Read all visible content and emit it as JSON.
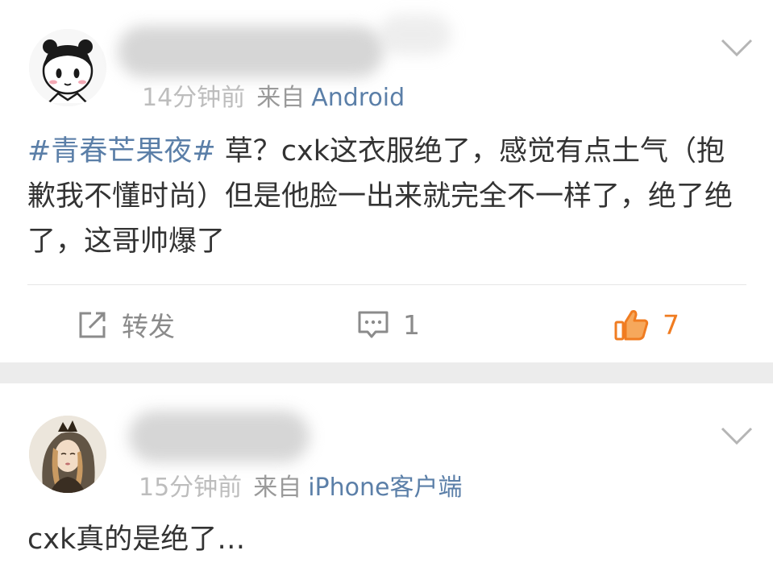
{
  "comments": [
    {
      "time": "14分钟前",
      "source_prefix": "来自",
      "device": "Android",
      "hashtag": "#青春芒果夜#",
      "text": "草？cxk这衣服绝了，感觉有点土气（抱歉我不懂时尚）但是他脸一出来就完全不一样了，绝了绝了，这哥帅爆了",
      "actions": {
        "repost_label": "转发",
        "comment_count": "1",
        "like_count": "7"
      }
    },
    {
      "time": "15分钟前",
      "source_prefix": "来自",
      "device": "iPhone客户端",
      "text": "cxk真的是绝了…"
    }
  ],
  "colors": {
    "link_blue": "#5b7fa8",
    "like_orange": "#f07c21",
    "separator_gray": "#ececec",
    "meta_gray": "#9a9a9a"
  },
  "icons": [
    "chevron-down-icon",
    "repost-icon",
    "comment-icon",
    "thumbs-up-icon"
  ]
}
